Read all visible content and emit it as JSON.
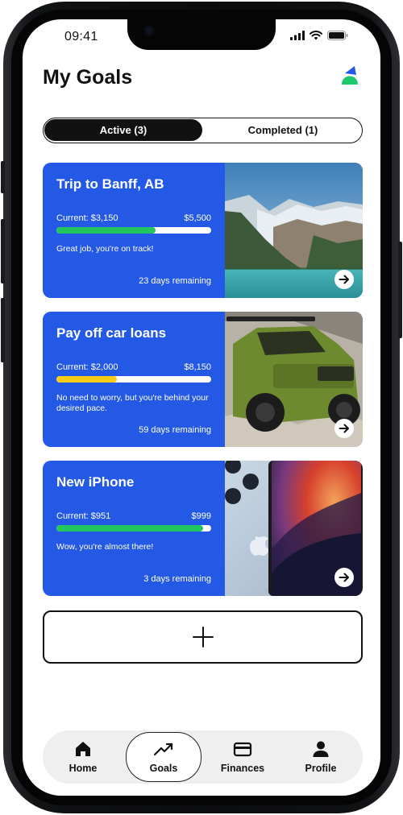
{
  "status_bar": {
    "time": "09:41"
  },
  "header": {
    "title": "My Goals"
  },
  "segment": {
    "active_label": "Active (3)",
    "completed_label": "Completed (1)"
  },
  "goals": [
    {
      "title": "Trip to Banff, AB",
      "current": "Current: $3,150",
      "target": "$5,500",
      "progress": 0.64,
      "bar_color": "#22c55e",
      "message": "Great job, you're on track!",
      "days": "23 days remaining",
      "image": "mountain-lake-photo"
    },
    {
      "title": "Pay off car loans",
      "current": "Current: $2,000",
      "target": "$8,150",
      "progress": 0.39,
      "bar_color": "#facc15",
      "message": "No need to worry, but you're behind your desired pace.",
      "days": "59 days remaining",
      "image": "green-suv-photo"
    },
    {
      "title": "New iPhone",
      "current": "Current: $951",
      "target": "$999",
      "progress": 0.95,
      "bar_color": "#22c55e",
      "message": "Wow, you're almost there!",
      "days": "3 days remaining",
      "image": "iphone-photo"
    }
  ],
  "add_goal": {
    "icon": "plus-icon"
  },
  "tabbar": {
    "items": [
      {
        "label": "Home",
        "icon": "home-icon"
      },
      {
        "label": "Goals",
        "icon": "trending-up-icon"
      },
      {
        "label": "Finances",
        "icon": "credit-card-icon"
      },
      {
        "label": "Profile",
        "icon": "person-icon"
      }
    ],
    "active": "Goals"
  },
  "colors": {
    "card_blue": "#2459e6",
    "text_dark": "#111111",
    "tab_bg": "#efefef"
  }
}
